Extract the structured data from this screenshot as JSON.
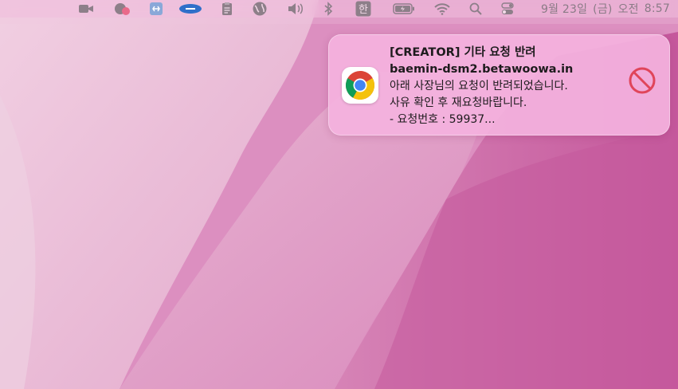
{
  "menubar": {
    "icons": [
      "zoom-icon",
      "notification-badge-icon",
      "teamviewer-icon",
      "vpn-icon",
      "clipboard-icon",
      "globe-icon",
      "volume-icon",
      "bluetooth-icon",
      "korean-input-icon",
      "battery-icon",
      "wifi-icon",
      "search-icon",
      "control-center-icon"
    ],
    "input_source_label": "한",
    "clock": {
      "date": "9월 23일",
      "weekday": "(금)",
      "ampm": "오전",
      "time": "8:57"
    }
  },
  "notification": {
    "app_icon": "chrome-icon",
    "title": "[CREATOR] 기타 요청 반려",
    "subtitle": "baemin-dsm2.betawoowa.in",
    "body_lines": [
      "아래 사장님의 요청이 반려되었습니다.",
      "사유 확인 후 재요청바랍니다.",
      "- 요청번호 : 59937..."
    ],
    "action_icon": "prohibited-icon",
    "colors": {
      "background": "#f4b2de",
      "text": "#1e1b1d",
      "block_icon": "#e0455a"
    }
  },
  "wallpaper": {
    "colors": [
      "#e9b9d6",
      "#d98dbd",
      "#c75a9e"
    ]
  }
}
